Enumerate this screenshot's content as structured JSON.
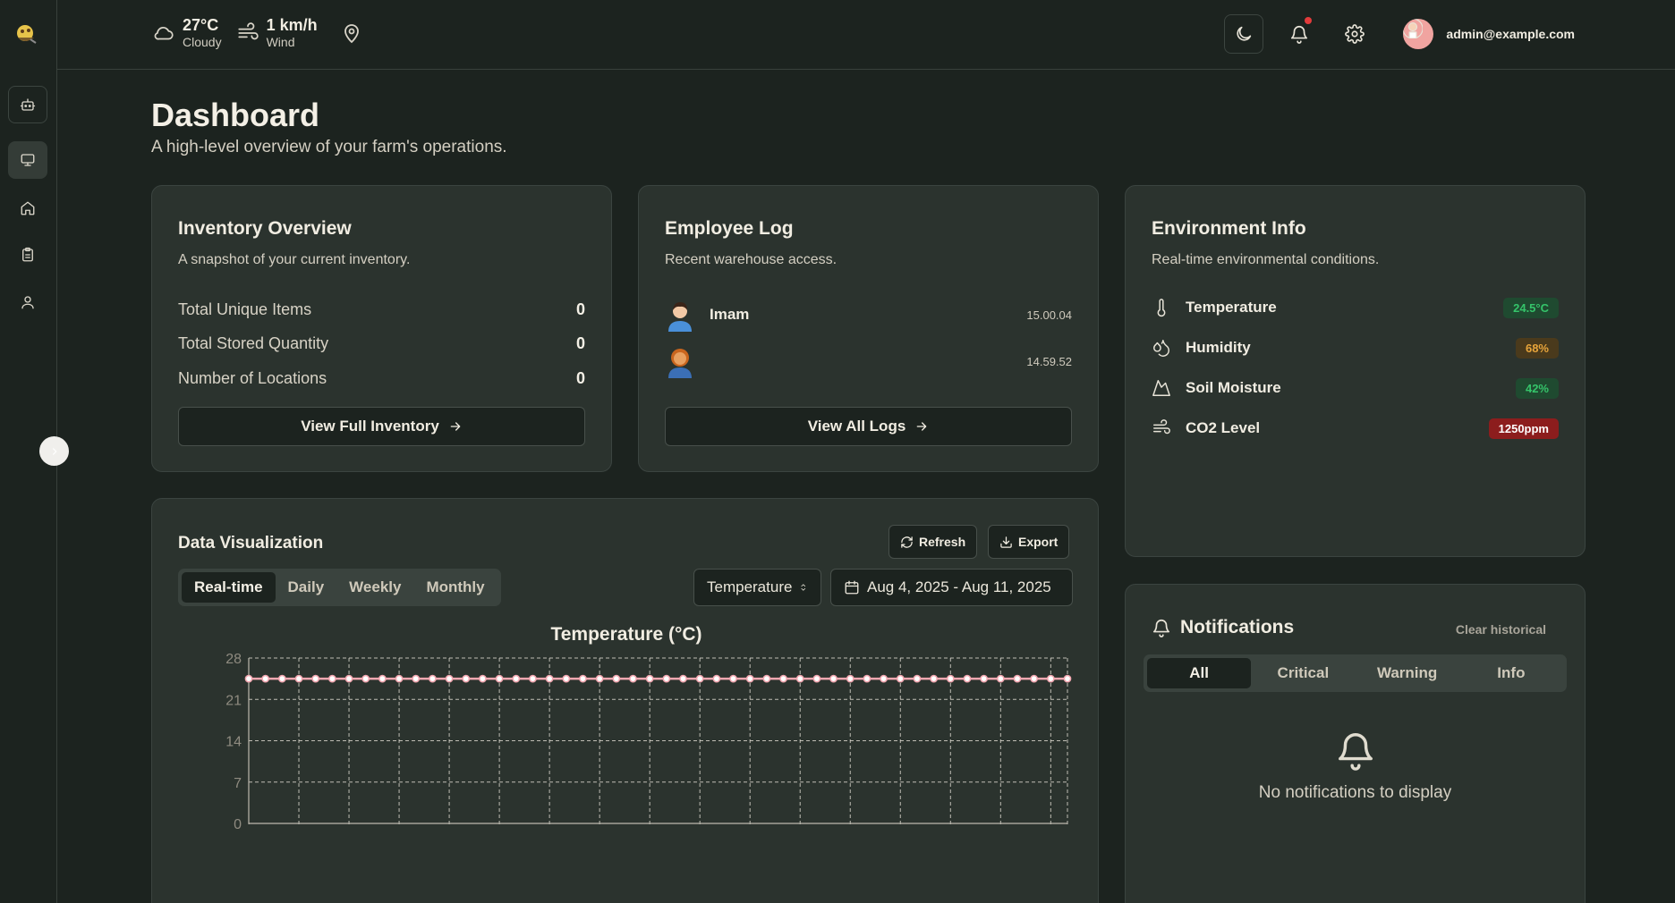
{
  "header": {
    "weather": {
      "temperature": "27°C",
      "condition": "Cloudy",
      "wind_speed": "1 km/h",
      "wind_label": "Wind"
    },
    "user_email": "admin@example.com",
    "has_unread_notifications": true
  },
  "sidebar": {
    "items": [
      {
        "icon": "bot-icon",
        "active": false
      },
      {
        "icon": "monitor-icon",
        "active": true
      },
      {
        "icon": "home-icon",
        "active": false
      },
      {
        "icon": "clipboard-icon",
        "active": false
      },
      {
        "icon": "user-icon",
        "active": false
      }
    ]
  },
  "page": {
    "title": "Dashboard",
    "subtitle": "A high-level overview of your farm's operations."
  },
  "inventory": {
    "title": "Inventory Overview",
    "subtitle": "A snapshot of your current inventory.",
    "rows": [
      {
        "label": "Total Unique Items",
        "value": "0"
      },
      {
        "label": "Total Stored Quantity",
        "value": "0"
      },
      {
        "label": "Number of Locations",
        "value": "0"
      }
    ],
    "button_label": "View Full Inventory"
  },
  "employee_log": {
    "title": "Employee Log",
    "subtitle": "Recent warehouse access.",
    "entries": [
      {
        "name": "Imam",
        "time": "15.00.04"
      },
      {
        "name": "",
        "time": "14.59.52"
      }
    ],
    "button_label": "View All Logs"
  },
  "environment": {
    "title": "Environment Info",
    "subtitle": "Real-time environmental conditions.",
    "metrics": [
      {
        "label": "Temperature",
        "value": "24.5°C",
        "icon": "thermometer-icon",
        "status_color": "#35c46a"
      },
      {
        "label": "Humidity",
        "value": "68%",
        "icon": "droplets-icon",
        "status_color": "#e7a43a"
      },
      {
        "label": "Soil Moisture",
        "value": "42%",
        "icon": "mountain-icon",
        "status_color": "#35c46a"
      },
      {
        "label": "CO2 Level",
        "value": "1250ppm",
        "icon": "wind-icon",
        "status_color": "#ffffff"
      }
    ]
  },
  "data_viz": {
    "title": "Data Visualization",
    "refresh_label": "Refresh",
    "export_label": "Export",
    "ranges": [
      "Real-time",
      "Daily",
      "Weekly",
      "Monthly"
    ],
    "active_range": "Real-time",
    "metric_select": "Temperature",
    "date_range": "Aug 4, 2025 - Aug 11, 2025"
  },
  "notifications": {
    "title": "Notifications",
    "clear_label": "Clear historical",
    "tabs": [
      "All",
      "Critical",
      "Warning",
      "Info"
    ],
    "active_tab": "All",
    "empty_text": "No notifications to display"
  },
  "chart_data": {
    "type": "line",
    "title": "Temperature (°C)",
    "xlabel": "",
    "ylabel": "",
    "ylim": [
      0,
      28
    ],
    "yticks": [
      0,
      7,
      14,
      21,
      28
    ],
    "grid": true,
    "series": [
      {
        "name": "",
        "color": "#f2a7b0",
        "values": [
          24.5,
          24.5,
          24.5,
          24.5,
          24.5,
          24.5,
          24.5,
          24.5,
          24.5,
          24.5,
          24.5,
          24.5,
          24.5,
          24.5,
          24.5,
          24.5,
          24.5,
          24.5,
          24.5,
          24.5,
          24.5,
          24.5,
          24.5,
          24.5,
          24.5,
          24.5,
          24.5,
          24.5,
          24.5,
          24.5,
          24.5,
          24.5,
          24.5,
          24.5,
          24.5,
          24.5,
          24.5,
          24.5,
          24.5,
          24.5,
          24.5,
          24.5,
          24.5,
          24.5,
          24.5,
          24.5,
          24.5,
          24.5,
          24.5,
          24.5
        ]
      }
    ]
  }
}
